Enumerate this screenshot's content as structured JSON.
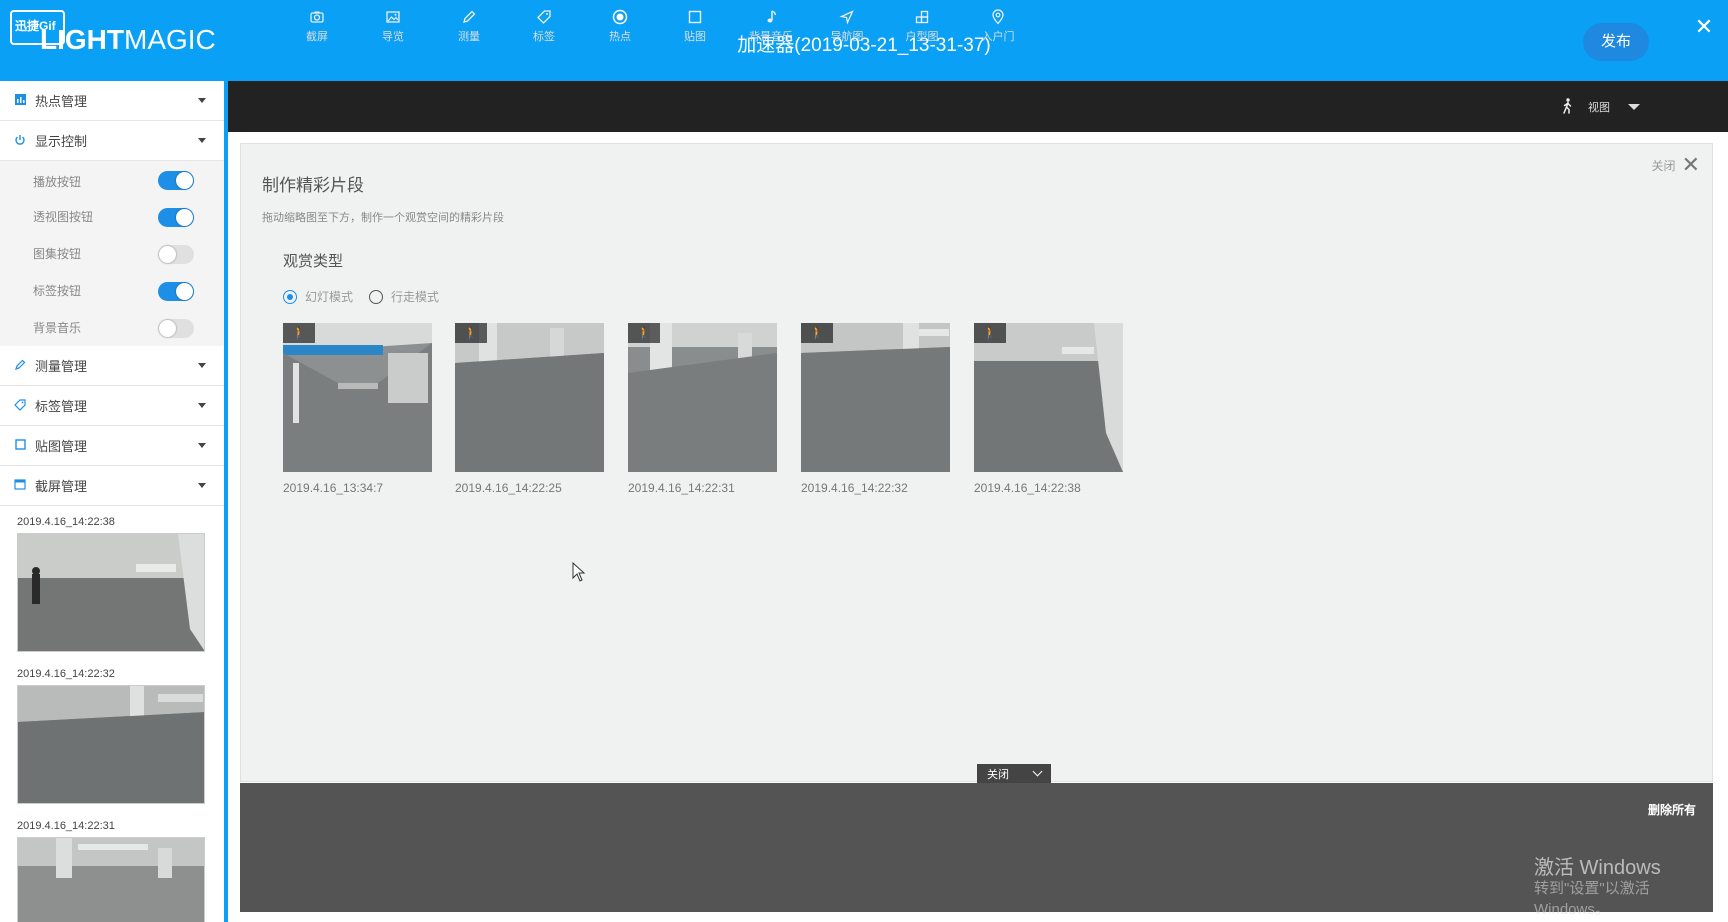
{
  "header": {
    "logo_badge": "迅捷Gif",
    "logo_bold": "LIGHT",
    "logo_light": "MAGIC",
    "title": "加速器(2019-03-21_13-31-37)",
    "publish_label": "发布",
    "close_symbol": "✕"
  },
  "sidebar": {
    "sections": {
      "hotspot": "热点管理",
      "display": "显示控制",
      "measure": "测量管理",
      "tags": "标签管理",
      "stickers": "贴图管理",
      "screenshots": "截屏管理"
    },
    "display_items": [
      {
        "label": "播放按钮",
        "on": true
      },
      {
        "label": "透视图按钮",
        "on": true
      },
      {
        "label": "图集按钮",
        "on": false
      },
      {
        "label": "标签按钮",
        "on": true
      },
      {
        "label": "背景音乐",
        "on": false
      }
    ],
    "screenshots": [
      {
        "label": "2019.4.16_14:22:38"
      },
      {
        "label": "2019.4.16_14:22:32"
      },
      {
        "label": "2019.4.16_14:22:31"
      }
    ]
  },
  "toolbar": {
    "items": [
      {
        "label": "截屏",
        "icon": "camera-icon"
      },
      {
        "label": "导览",
        "icon": "image-icon"
      },
      {
        "label": "测量",
        "icon": "pencil-icon"
      },
      {
        "label": "标签",
        "icon": "tag-icon"
      },
      {
        "label": "热点",
        "icon": "hotspot-icon"
      },
      {
        "label": "贴图",
        "icon": "square-icon"
      },
      {
        "label": "背景音乐",
        "icon": "music-icon"
      },
      {
        "label": "导航图",
        "icon": "navigation-icon"
      },
      {
        "label": "户型图",
        "icon": "floorplan-icon"
      },
      {
        "label": "入户门",
        "icon": "location-pin-icon"
      }
    ],
    "view_label": "视图"
  },
  "panel": {
    "close_label": "关闭",
    "title": "制作精彩片段",
    "description": "拖动缩略图至下方，制作一个观赏空间的精彩片段",
    "subtitle": "观赏类型",
    "modes": [
      {
        "label": "幻灯模式",
        "selected": true
      },
      {
        "label": "行走模式",
        "selected": false
      }
    ],
    "thumbnails": [
      {
        "caption": "2019.4.16_13:34:7"
      },
      {
        "caption": "2019.4.16_14:22:25"
      },
      {
        "caption": "2019.4.16_14:22:31"
      },
      {
        "caption": "2019.4.16_14:22:32"
      },
      {
        "caption": "2019.4.16_14:22:38"
      }
    ]
  },
  "bottom": {
    "tab_label": "关闭",
    "delete_all": "删除所有"
  },
  "watermark": {
    "line1": "激活 Windows",
    "line2": "转到\"设置\"以激活 Windows。"
  },
  "colors": {
    "accent": "#0aa0f5",
    "toggle_on": "#1e8fe6",
    "toolbar_bg": "#222222",
    "panel_bg": "#f0f2f1"
  }
}
